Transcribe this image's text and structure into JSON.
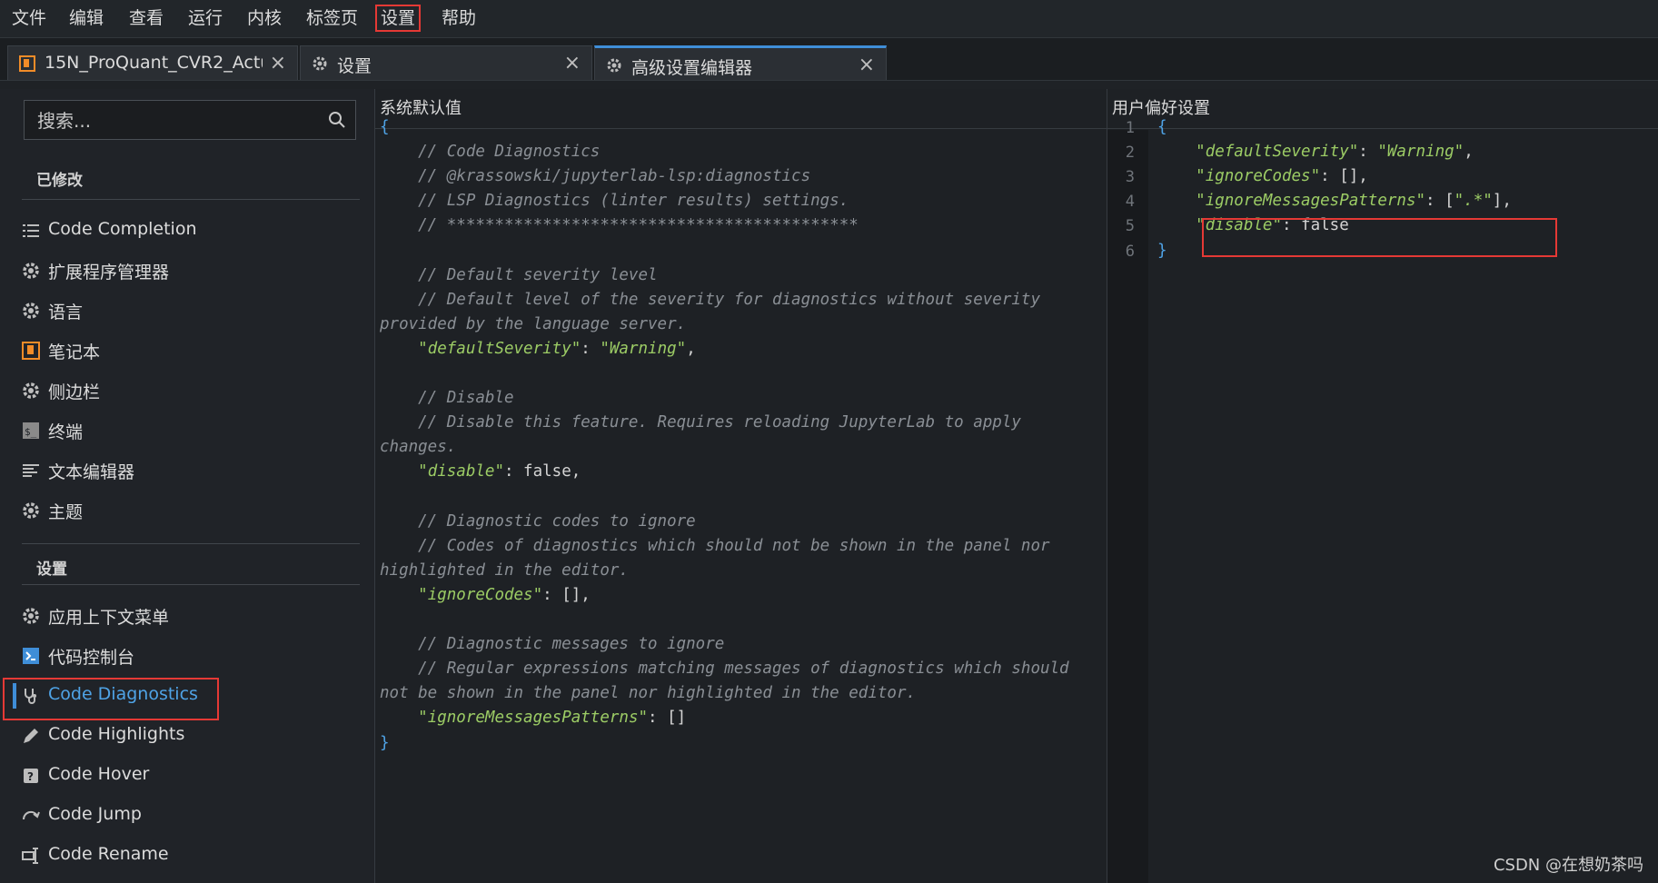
{
  "menubar": {
    "items": [
      "文件",
      "编辑",
      "查看",
      "运行",
      "内核",
      "标签页",
      "设置",
      "帮助"
    ]
  },
  "tabs": [
    {
      "label": "15N_ProQuant_CVR2_Actual_",
      "icon": "notebook-icon"
    },
    {
      "label": "设置",
      "icon": "gear-icon"
    },
    {
      "label": "高级设置编辑器",
      "icon": "gear-icon",
      "active": true
    }
  ],
  "sidebar": {
    "search_placeholder": "搜索...",
    "modified_title": "已修改",
    "modified_items": [
      {
        "label": "Code Completion",
        "icon": "list-icon"
      },
      {
        "label": "扩展程序管理器",
        "icon": "gear-icon"
      },
      {
        "label": "语言",
        "icon": "gear-icon"
      },
      {
        "label": "笔记本",
        "icon": "notebook-icon"
      },
      {
        "label": "侧边栏",
        "icon": "gear-icon"
      },
      {
        "label": "终端",
        "icon": "terminal-icon"
      },
      {
        "label": "文本编辑器",
        "icon": "text-editor-icon"
      },
      {
        "label": "主题",
        "icon": "gear-icon"
      }
    ],
    "settings_title": "设置",
    "settings_items": [
      {
        "label": "应用上下文菜单",
        "icon": "gear-icon"
      },
      {
        "label": "代码控制台",
        "icon": "console-icon"
      },
      {
        "label": "Code Diagnostics",
        "icon": "stethoscope-icon",
        "active": true
      },
      {
        "label": "Code Highlights",
        "icon": "pencil-icon"
      },
      {
        "label": "Code Hover",
        "icon": "help-icon"
      },
      {
        "label": "Code Jump",
        "icon": "jump-icon"
      },
      {
        "label": "Code Rename",
        "icon": "rename-icon"
      }
    ]
  },
  "default_panel": {
    "title": "系统默认值",
    "lines": [
      "{",
      "    // Code Diagnostics",
      "    // @krassowski/jupyterlab-lsp:diagnostics",
      "    // LSP Diagnostics (linter results) settings.",
      "    // *******************************************",
      "",
      "    // Default severity level",
      "    // Default level of the severity for diagnostics without severity",
      "provided by the language server.",
      "    \"defaultSeverity\": \"Warning\",",
      "",
      "    // Disable",
      "    // Disable this feature. Requires reloading JupyterLab to apply",
      "changes.",
      "    \"disable\": false,",
      "",
      "    // Diagnostic codes to ignore",
      "    // Codes of diagnostics which should not be shown in the panel nor",
      "highlighted in the editor.",
      "    \"ignoreCodes\": [],",
      "",
      "    // Diagnostic messages to ignore",
      "    // Regular expressions matching messages of diagnostics which should",
      "not be shown in the panel nor highlighted in the editor.",
      "    \"ignoreMessagesPatterns\": []",
      "}"
    ]
  },
  "user_panel": {
    "title": "用户偏好设置",
    "line_numbers": [
      "1",
      "2",
      "3",
      "4",
      "5",
      "6"
    ],
    "lines": [
      "{",
      "    \"defaultSeverity\": \"Warning\",",
      "    \"ignoreCodes\": [],",
      "    \"ignoreMessagesPatterns\": [\".*\"],",
      "    \"disable\": false",
      "}"
    ]
  },
  "watermark": "CSDN @在想奶茶吗",
  "colors": {
    "accent": "#3f8ed8",
    "highlight_box": "#e53935",
    "string": "#9ccc65",
    "comment": "#8a8f95"
  }
}
